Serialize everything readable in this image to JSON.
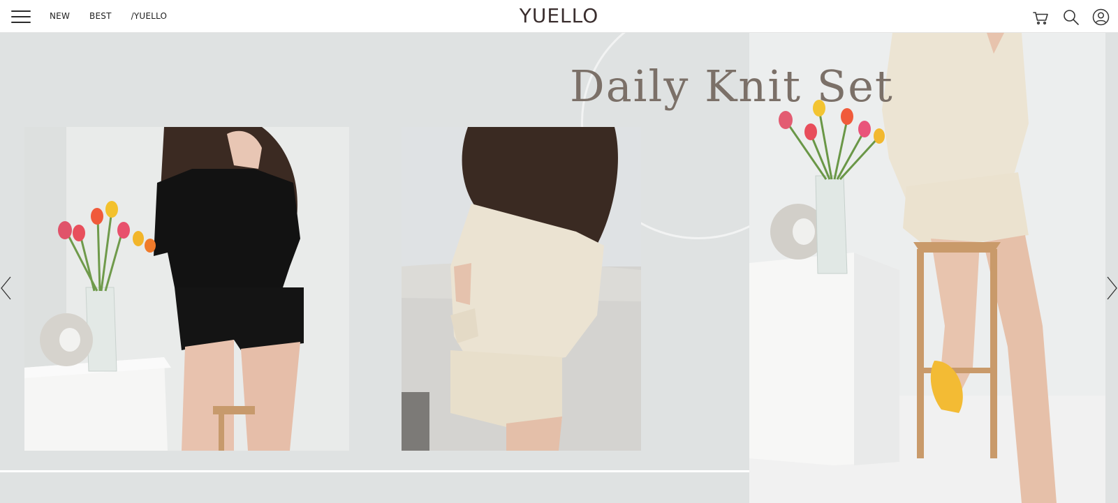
{
  "header": {
    "nav": [
      "NEW",
      "BEST",
      "/YUELLO"
    ],
    "logo": "YUELLO",
    "icons": [
      "menu-icon",
      "cart-icon",
      "search-icon",
      "user-icon"
    ]
  },
  "hero": {
    "title": "Daily Knit Set",
    "background_color": "#dfe2e2",
    "title_color": "#7b7068",
    "photos": [
      {
        "alt": "black knit set"
      },
      {
        "alt": "beige knit set back"
      },
      {
        "alt": "beige knit set seated"
      }
    ],
    "arrows": [
      "chevron-left-icon",
      "chevron-right-icon"
    ]
  }
}
